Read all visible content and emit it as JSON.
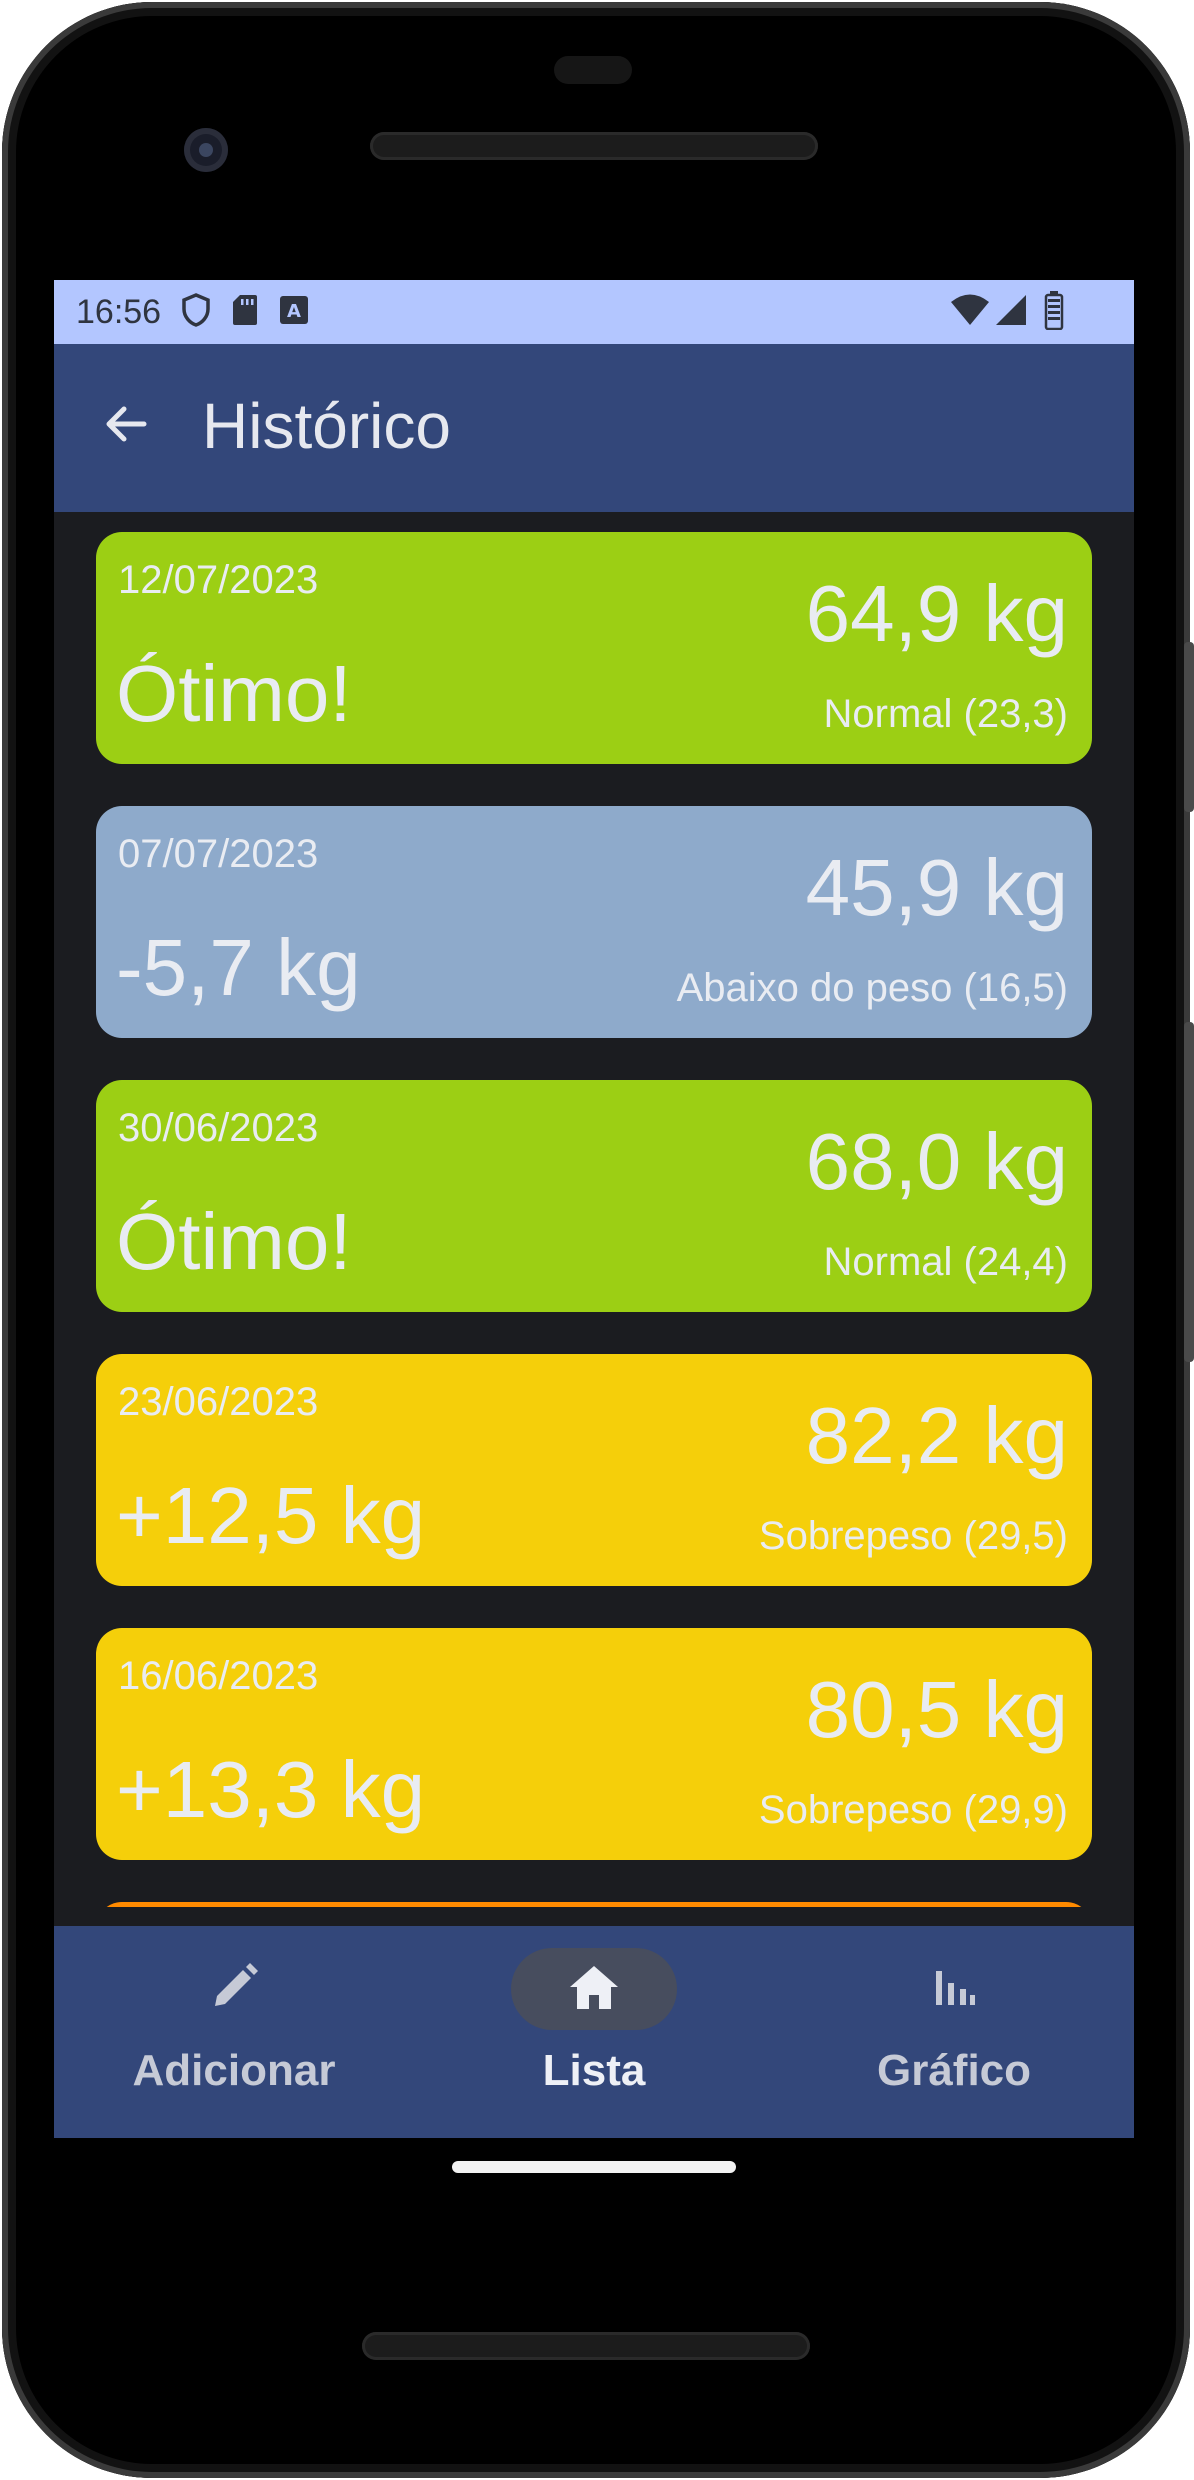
{
  "status_bar": {
    "time": "16:56",
    "left_icons": [
      "shield-icon",
      "sd-card-icon",
      "keyboard-a-icon"
    ],
    "right_icons": [
      "wifi-icon",
      "cell-signal-icon",
      "battery-icon"
    ]
  },
  "app_bar": {
    "title": "Histórico",
    "back_icon": "arrow-back-icon"
  },
  "entries": [
    {
      "date": "12/07/2023",
      "status": "Ótimo!",
      "weight": "64,9 kg",
      "bmi": "Normal (23,3)",
      "color": "#9ccf14"
    },
    {
      "date": "07/07/2023",
      "status": "-5,7 kg",
      "weight": "45,9 kg",
      "bmi": "Abaixo do peso (16,5)",
      "color": "#8eaacb"
    },
    {
      "date": "30/06/2023",
      "status": "Ótimo!",
      "weight": "68,0 kg",
      "bmi": "Normal (24,4)",
      "color": "#9ccf14"
    },
    {
      "date": "23/06/2023",
      "status": "+12,5 kg",
      "weight": "82,2 kg",
      "bmi": "Sobrepeso (29,5)",
      "color": "#f5cf0a"
    },
    {
      "date": "16/06/2023",
      "status": "+13,3 kg",
      "weight": "80,5 kg",
      "bmi": "Sobrepeso (29,9)",
      "color": "#f5cf0a"
    },
    {
      "date": "",
      "status": "",
      "weight": "",
      "bmi": "",
      "color": "#ff8a00"
    }
  ],
  "bottom_nav": {
    "items": [
      {
        "label": "Adicionar",
        "icon": "pencil-icon",
        "active": false
      },
      {
        "label": "Lista",
        "icon": "home-icon",
        "active": true
      },
      {
        "label": "Gráfico",
        "icon": "bar-chart-icon",
        "active": false
      }
    ]
  },
  "colors": {
    "status_bar": "#b3c6ff",
    "app_bar": "#33477a",
    "background": "#1b1c20",
    "normal": "#9ccf14",
    "underweight": "#8eaacb",
    "overweight": "#f5cf0a",
    "obese": "#ff8a00"
  }
}
